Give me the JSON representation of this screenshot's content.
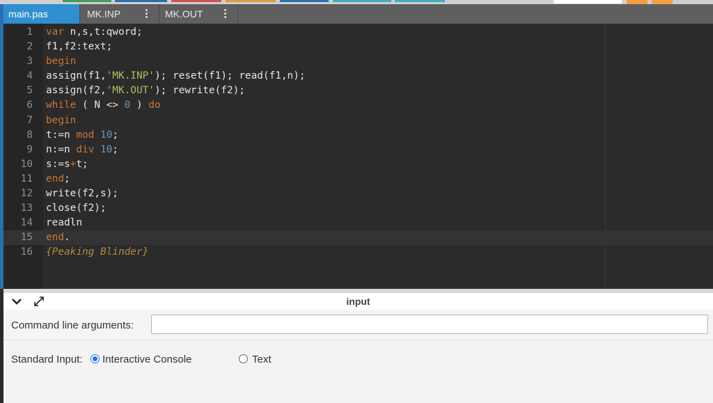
{
  "tabs": [
    {
      "label": "main.pas"
    },
    {
      "label": "MK.INP"
    },
    {
      "label": "MK.OUT"
    }
  ],
  "kebab_glyph": "⋮",
  "editor": {
    "lines": [
      {
        "n": "1",
        "segs": [
          [
            "kw",
            "var"
          ],
          [
            "t",
            " n,s,t:qword;"
          ]
        ]
      },
      {
        "n": "2",
        "segs": [
          [
            "t",
            "f1,f2:text;"
          ]
        ]
      },
      {
        "n": "3",
        "segs": [
          [
            "kw",
            "begin"
          ]
        ]
      },
      {
        "n": "4",
        "segs": [
          [
            "t",
            "assign(f1,"
          ],
          [
            "str",
            "'MK.INP'"
          ],
          [
            "t",
            "); reset(f1); read(f1,n);"
          ]
        ]
      },
      {
        "n": "5",
        "segs": [
          [
            "t",
            "assign(f2,"
          ],
          [
            "str",
            "'MK.OUT'"
          ],
          [
            "t",
            "); rewrite(f2);"
          ]
        ]
      },
      {
        "n": "6",
        "segs": [
          [
            "kw",
            "while"
          ],
          [
            "t",
            " ( N <> "
          ],
          [
            "num",
            "0"
          ],
          [
            "t",
            " ) "
          ],
          [
            "kw",
            "do"
          ]
        ]
      },
      {
        "n": "7",
        "segs": [
          [
            "kw",
            "begin"
          ]
        ]
      },
      {
        "n": "8",
        "segs": [
          [
            "t",
            "t:=n "
          ],
          [
            "kw",
            "mod"
          ],
          [
            "t",
            " "
          ],
          [
            "num",
            "10"
          ],
          [
            "t",
            ";"
          ]
        ]
      },
      {
        "n": "9",
        "segs": [
          [
            "t",
            "n:=n "
          ],
          [
            "kw",
            "div"
          ],
          [
            "t",
            " "
          ],
          [
            "num",
            "10"
          ],
          [
            "t",
            ";"
          ]
        ]
      },
      {
        "n": "10",
        "segs": [
          [
            "t",
            "s:=s"
          ],
          [
            "op",
            "+"
          ],
          [
            "t",
            "t;"
          ]
        ]
      },
      {
        "n": "11",
        "segs": [
          [
            "kw",
            "end"
          ],
          [
            "t",
            ";"
          ]
        ]
      },
      {
        "n": "12",
        "segs": [
          [
            "t",
            "write(f2,s);"
          ]
        ]
      },
      {
        "n": "13",
        "segs": [
          [
            "t",
            "close(f2);"
          ]
        ]
      },
      {
        "n": "14",
        "segs": [
          [
            "t",
            "readln"
          ]
        ]
      },
      {
        "n": "15",
        "segs": [
          [
            "kw",
            "end"
          ],
          [
            "t",
            "."
          ]
        ],
        "current": true
      },
      {
        "n": "16",
        "segs": [
          [
            "cmt",
            "{Peaking Blinder}"
          ]
        ]
      }
    ]
  },
  "input_panel": {
    "title": "input",
    "cmd_label": "Command line arguments:",
    "cmd_value": "",
    "stdin_label": "Standard Input:",
    "option_console": "Interactive Console",
    "option_text": "Text",
    "selected": "Interactive Console"
  },
  "colors": {
    "active_tab": "#2f8fd0",
    "keyword": "#c8763a",
    "number": "#6897bb",
    "string": "#a5c25c",
    "comment": "#b6883b",
    "radio_selected": "#1a73e8"
  }
}
